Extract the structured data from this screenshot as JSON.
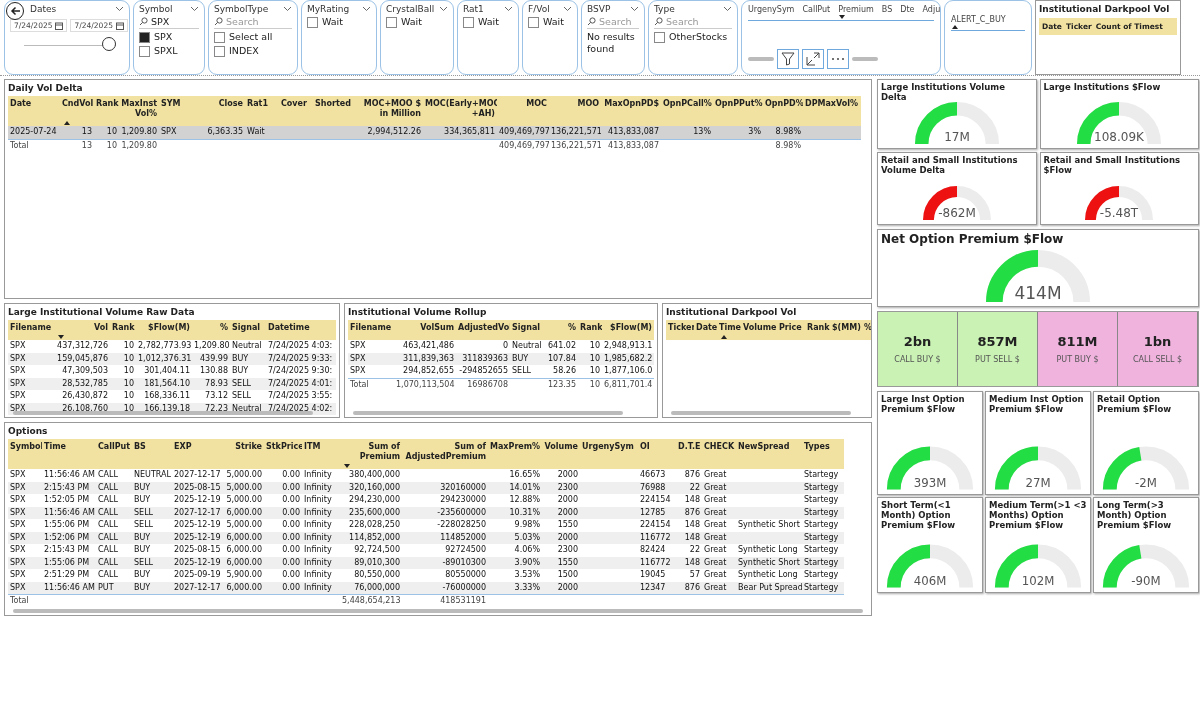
{
  "filters": [
    {
      "kind": "date",
      "title": "Dates",
      "from": "7/24/2025",
      "to": "7/24/2025",
      "level": 1
    },
    {
      "kind": "list",
      "title": "Symbol",
      "search": {
        "value": "SPX"
      },
      "items": [
        {
          "label": "SPX",
          "checked": true
        },
        {
          "label": "SPXL",
          "checked": false
        }
      ]
    },
    {
      "kind": "list",
      "title": "SymbolType",
      "search": {
        "placeholder": "Search"
      },
      "items": [
        {
          "label": "Select all",
          "checked": false
        },
        {
          "label": "INDEX",
          "checked": false
        }
      ]
    },
    {
      "kind": "list",
      "title": "MyRating",
      "items": [
        {
          "label": "Wait",
          "checked": false
        }
      ]
    },
    {
      "kind": "list",
      "title": "CrystalBall",
      "items": [
        {
          "label": "Wait",
          "checked": false
        }
      ]
    },
    {
      "kind": "list",
      "title": "Rat1",
      "items": [
        {
          "label": "Wait",
          "checked": false
        }
      ]
    },
    {
      "kind": "list",
      "title": "F/Vol",
      "items": [
        {
          "label": "Wait",
          "checked": false
        }
      ]
    },
    {
      "kind": "list",
      "title": "BSVP",
      "search": {
        "placeholder": "Search"
      },
      "message": "No results found"
    },
    {
      "kind": "list",
      "title": "Type",
      "search": {
        "placeholder": "Search"
      },
      "items": [
        {
          "label": "OtherStocks",
          "checked": false
        }
      ]
    }
  ],
  "top_table": {
    "columns": [
      {
        "label": "UrgenySym"
      },
      {
        "label": "CallPut"
      },
      {
        "label": "Premium",
        "sorted": true,
        "descending": true
      },
      {
        "label": "BS"
      },
      {
        "label": "Dte"
      },
      {
        "label": "Adju"
      }
    ]
  },
  "alert_table": {
    "columns": [
      {
        "label": "ALERT_C_BUY",
        "sorted": true,
        "descending": false
      }
    ]
  },
  "darkpool_summary": {
    "title": "Institutional Darkpool Vol",
    "columns": [
      {
        "label": "Date"
      },
      {
        "label": "Ticker"
      },
      {
        "label": "Count of Timest"
      }
    ]
  },
  "daily_vol_delta": {
    "title": "Daily Vol Delta",
    "columns": [
      {
        "label": "Date"
      },
      {
        "label": "CndVol",
        "sorted": true,
        "descending": false
      },
      {
        "label": "Rank"
      },
      {
        "label": "MaxInst Vol%"
      },
      {
        "label": "SYM"
      },
      {
        "label": "Close"
      },
      {
        "label": "Rat1"
      },
      {
        "label": "Cover"
      },
      {
        "label": "Shorted"
      },
      {
        "label": "MOC+MOO $ in Million"
      },
      {
        "label": "MOC(Early+MOC +AH)"
      },
      {
        "label": "MOC"
      },
      {
        "label": "MOO"
      },
      {
        "label": "MaxOpnPD$"
      },
      {
        "label": "OpnPCall%"
      },
      {
        "label": "OpnPPut%"
      },
      {
        "label": "OpnPD%"
      },
      {
        "label": "DPMaxVol%"
      }
    ],
    "rows": [
      {
        "selected": true,
        "date": "2025-07-24",
        "cnd_vol": "13",
        "rank": "10",
        "max_inst_vol": "1,209.80",
        "sym": "SPX",
        "close": "6,363.35",
        "rat1": "Wait",
        "moc_moo": "2,994,512.26",
        "moc_early": "334,365,811",
        "moc": "409,469,797",
        "moo": "136,221,571",
        "max_opn_pd": "413,833,087",
        "opn_p_call": "13%",
        "opn_p_put": "3%",
        "opn_pd": "8.98%"
      }
    ],
    "total": {
      "date": "Total",
      "cnd_vol": "13",
      "rank": "10",
      "max_inst_vol": "1,209.80",
      "moc": "409,469,797",
      "moo": "136,221,571",
      "max_opn_pd": "413,833,087",
      "opn_pd": "8.98%"
    }
  },
  "raw_data": {
    "title": "Large Institutional Volume Raw Data",
    "columns": [
      {
        "label": "Filename"
      },
      {
        "label": "Vol",
        "sorted": true,
        "descending": true
      },
      {
        "label": "Rank"
      },
      {
        "label": "$Flow(M)"
      },
      {
        "label": "%"
      },
      {
        "label": "Signal"
      },
      {
        "label": "Datetime"
      }
    ],
    "rows": [
      {
        "filename": "SPX",
        "vol": "437,312,726",
        "rank": "10",
        "flow": "2,782,773.93",
        "pct": "1,209.80",
        "signal": "Neutral",
        "datetime": "7/24/2025 4:03:"
      },
      {
        "filename": "SPX",
        "vol": "159,045,876",
        "rank": "10",
        "flow": "1,012,376.31",
        "pct": "439.99",
        "signal": "BUY",
        "datetime": "7/24/2025 9:33:"
      },
      {
        "filename": "SPX",
        "vol": "47,309,503",
        "rank": "10",
        "flow": "301,404.11",
        "pct": "130.88",
        "signal": "BUY",
        "datetime": "7/24/2025 9:30:"
      },
      {
        "filename": "SPX",
        "vol": "28,532,785",
        "rank": "10",
        "flow": "181,564.10",
        "pct": "78.93",
        "signal": "SELL",
        "datetime": "7/24/2025 4:01:"
      },
      {
        "filename": "SPX",
        "vol": "26,430,872",
        "rank": "10",
        "flow": "168,336.11",
        "pct": "73.12",
        "signal": "SELL",
        "datetime": "7/24/2025 3:55:"
      },
      {
        "filename": "SPX",
        "vol": "26,108,760",
        "rank": "10",
        "flow": "166,139.18",
        "pct": "72.23",
        "signal": "Neutral",
        "datetime": "7/24/2025 4:02:"
      }
    ]
  },
  "rollup": {
    "title": "Institutional Volume Rollup",
    "columns": [
      {
        "label": "Filename"
      },
      {
        "label": "VolSum"
      },
      {
        "label": "AdjustedVol"
      },
      {
        "label": "Signal"
      },
      {
        "label": "%"
      },
      {
        "label": "Rank"
      },
      {
        "label": "$Flow(M)"
      }
    ],
    "rows": [
      {
        "filename": "SPX",
        "vol_sum": "463,421,486",
        "adjusted_vol": "0",
        "signal": "Neutral",
        "pct": "641.02",
        "rank": "10",
        "flow": "2,948,913.1"
      },
      {
        "filename": "SPX",
        "vol_sum": "311,839,363",
        "adjusted_vol": "311839363",
        "signal": "BUY",
        "pct": "107.84",
        "rank": "10",
        "flow": "1,985,682.2"
      },
      {
        "filename": "SPX",
        "vol_sum": "294,852,655",
        "adjusted_vol": "-294852655",
        "signal": "SELL",
        "pct": "58.26",
        "rank": "10",
        "flow": "1,877,106.0"
      }
    ],
    "total": {
      "filename": "Total",
      "vol_sum": "1,070,113,504",
      "adjusted_vol": "16986708",
      "pct": "123.35",
      "rank": "10",
      "flow": "6,811,701.4"
    }
  },
  "darkpool": {
    "title": "Institutional Darkpool Vol",
    "columns": [
      {
        "label": "Ticker"
      },
      {
        "label": "Date"
      },
      {
        "label": "Time",
        "sorted": true,
        "descending": false
      },
      {
        "label": "Volume"
      },
      {
        "label": "Price"
      },
      {
        "label": "Rank"
      },
      {
        "label": "$(MM)"
      },
      {
        "label": "%"
      }
    ]
  },
  "options": {
    "title": "Options",
    "columns": [
      {
        "label": "Symbol"
      },
      {
        "label": "Time"
      },
      {
        "label": "CallPut"
      },
      {
        "label": "BS"
      },
      {
        "label": "EXP"
      },
      {
        "label": "Strike"
      },
      {
        "label": "StkPrice"
      },
      {
        "label": "ITM"
      },
      {
        "label": "Sum of Premium",
        "sorted": true,
        "descending": true
      },
      {
        "label": "Sum of AdjustedPremium"
      },
      {
        "label": "MaxPrem%"
      },
      {
        "label": "Volume"
      },
      {
        "label": "UrgenySym"
      },
      {
        "label": "OI"
      },
      {
        "label": "D.T.E"
      },
      {
        "label": "CHECK"
      },
      {
        "label": "NewSpread"
      },
      {
        "label": "Types"
      }
    ],
    "rows": [
      {
        "symbol": "SPX",
        "time": "11:56:46 AM",
        "call_put": "CALL",
        "bs": "NEUTRAL",
        "exp": "2027-12-17",
        "strike": "5,000.00",
        "stk_price": "0.00",
        "itm": "Infinity",
        "sum_premium": "380,400,000",
        "max_prem": "16.65%",
        "volume": "2000",
        "oi": "46673",
        "dte": "876",
        "check": "Great",
        "types": "Startegy"
      },
      {
        "symbol": "SPX",
        "time": "2:15:43 PM",
        "call_put": "CALL",
        "bs": "BUY",
        "exp": "2025-08-15",
        "strike": "5,000.00",
        "stk_price": "0.00",
        "itm": "Infinity",
        "sum_premium": "320,160,000",
        "sum_adjusted_premium": "320160000",
        "max_prem": "14.01%",
        "volume": "2300",
        "oi": "76988",
        "dte": "22",
        "check": "Great",
        "types": "Startegy"
      },
      {
        "symbol": "SPX",
        "time": "1:52:05 PM",
        "call_put": "CALL",
        "bs": "BUY",
        "exp": "2025-12-19",
        "strike": "5,000.00",
        "stk_price": "0.00",
        "itm": "Infinity",
        "sum_premium": "294,230,000",
        "sum_adjusted_premium": "294230000",
        "max_prem": "12.88%",
        "volume": "2000",
        "oi": "224154",
        "dte": "148",
        "check": "Great",
        "types": "Startegy"
      },
      {
        "symbol": "SPX",
        "time": "11:56:46 AM",
        "call_put": "CALL",
        "bs": "SELL",
        "exp": "2027-12-17",
        "strike": "6,000.00",
        "stk_price": "0.00",
        "itm": "Infinity",
        "sum_premium": "235,600,000",
        "sum_adjusted_premium": "-235600000",
        "max_prem": "10.31%",
        "volume": "2000",
        "oi": "12785",
        "dte": "876",
        "check": "Great",
        "types": "Startegy"
      },
      {
        "symbol": "SPX",
        "time": "1:55:06 PM",
        "call_put": "CALL",
        "bs": "SELL",
        "exp": "2025-12-19",
        "strike": "5,000.00",
        "stk_price": "0.00",
        "itm": "Infinity",
        "sum_premium": "228,028,250",
        "sum_adjusted_premium": "-228028250",
        "max_prem": "9.98%",
        "volume": "1550",
        "oi": "224154",
        "dte": "148",
        "check": "Great",
        "new_spread": "Synthetic Short",
        "types": "Startegy"
      },
      {
        "symbol": "SPX",
        "time": "1:52:06 PM",
        "call_put": "CALL",
        "bs": "BUY",
        "exp": "2025-12-19",
        "strike": "6,000.00",
        "stk_price": "0.00",
        "itm": "Infinity",
        "sum_premium": "114,852,000",
        "sum_adjusted_premium": "114852000",
        "max_prem": "5.03%",
        "volume": "2000",
        "oi": "116772",
        "dte": "148",
        "check": "Great",
        "types": "Startegy"
      },
      {
        "symbol": "SPX",
        "time": "2:15:43 PM",
        "call_put": "CALL",
        "bs": "BUY",
        "exp": "2025-08-15",
        "strike": "6,000.00",
        "stk_price": "0.00",
        "itm": "Infinity",
        "sum_premium": "92,724,500",
        "sum_adjusted_premium": "92724500",
        "max_prem": "4.06%",
        "volume": "2300",
        "oi": "82424",
        "dte": "22",
        "check": "Great",
        "new_spread": "Synthetic Long",
        "types": "Startegy"
      },
      {
        "symbol": "SPX",
        "time": "1:55:06 PM",
        "call_put": "CALL",
        "bs": "SELL",
        "exp": "2025-12-19",
        "strike": "6,000.00",
        "stk_price": "0.00",
        "itm": "Infinity",
        "sum_premium": "89,010,300",
        "sum_adjusted_premium": "-89010300",
        "max_prem": "3.90%",
        "volume": "1550",
        "oi": "116772",
        "dte": "148",
        "check": "Great",
        "new_spread": "Synthetic Short",
        "types": "Startegy"
      },
      {
        "symbol": "SPX",
        "time": "2:51:29 PM",
        "call_put": "CALL",
        "bs": "BUY",
        "exp": "2025-09-19",
        "strike": "5,900.00",
        "stk_price": "0.00",
        "itm": "Infinity",
        "sum_premium": "80,550,000",
        "sum_adjusted_premium": "80550000",
        "max_prem": "3.53%",
        "volume": "1500",
        "oi": "19045",
        "dte": "57",
        "check": "Great",
        "new_spread": "Synthetic Long",
        "types": "Startegy"
      },
      {
        "symbol": "SPX",
        "time": "11:56:46 AM",
        "call_put": "PUT",
        "bs": "BUY",
        "exp": "2027-12-17",
        "strike": "6,000.00",
        "stk_price": "0.00",
        "itm": "Infinity",
        "sum_premium": "76,000,000",
        "sum_adjusted_premium": "-76000000",
        "max_prem": "3.33%",
        "volume": "2000",
        "oi": "12347",
        "dte": "876",
        "check": "Great",
        "new_spread": "Bear Put Spread",
        "types": "Startegy"
      }
    ],
    "total": {
      "symbol": "Total",
      "sum_premium": "5,448,654,213",
      "sum_adjusted_premium": "418531191"
    }
  },
  "gauges_top": [
    {
      "title": "Large Institutions Volume Delta",
      "value": "17M",
      "level": 0.5,
      "color": "#22dd44"
    },
    {
      "title": "Large Institutions $Flow",
      "value": "108.09K",
      "level": 0.5,
      "color": "#22dd44"
    },
    {
      "title": "Retail and Small Institutions Volume Delta",
      "value": "-862M",
      "level": 0.5,
      "color": "#ee1111"
    },
    {
      "title": "Retail and Small Institutions $Flow",
      "value": "-5.48T",
      "level": 0.5,
      "color": "#ee1111"
    }
  ],
  "net_gauge": {
    "title": "Net Option Premium $Flow",
    "value": "414M",
    "level": 0.5,
    "color": "#22dd44"
  },
  "premium_cards": [
    {
      "value": "2bn",
      "label": "CALL BUY $",
      "color": "#c9f2b4"
    },
    {
      "value": "857M",
      "label": "PUT SELL $",
      "color": "#c9f2b4"
    },
    {
      "value": "811M",
      "label": "PUT BUY $",
      "color": "#efb3de"
    },
    {
      "value": "1bn",
      "label": "CALL SELL $",
      "color": "#efb3de"
    }
  ],
  "gauges_bottom": [
    {
      "title": "Large Inst Option Premium $Flow",
      "value": "393M",
      "level": 0.5,
      "color": "#22dd44"
    },
    {
      "title": "Medium Inst Option Premium $Flow",
      "value": "27M",
      "level": 0.5,
      "color": "#22dd44"
    },
    {
      "title": "Retail Option Premium $Flow",
      "value": "-2M",
      "level": 0.45,
      "color": "#22dd44"
    },
    {
      "title": "Short Term(<1 Month) Option Premium $Flow",
      "value": "406M",
      "level": 0.5,
      "color": "#22dd44"
    },
    {
      "title": "Medium Term(>1 <3 Months) Option Premium $Flow",
      "value": "102M",
      "level": 0.5,
      "color": "#22dd44"
    },
    {
      "title": "Long Term(>3 Month) Option Premium $Flow",
      "value": "-90M",
      "level": 0.45,
      "color": "#22dd44"
    }
  ]
}
